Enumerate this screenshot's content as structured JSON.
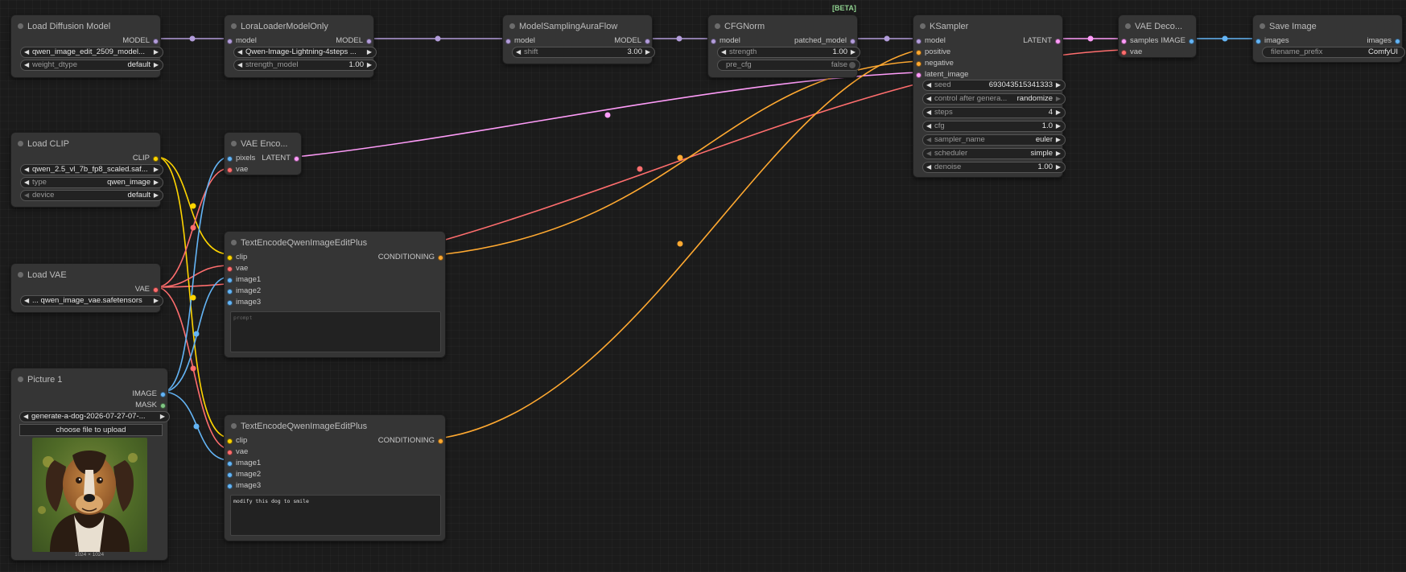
{
  "nodes": {
    "load_diffusion": {
      "title": "Load Diffusion Model",
      "out_model": "MODEL",
      "unet_name": "qwen_image_edit_2509_model...",
      "weight_dtype_label": "weight_dtype",
      "weight_dtype": "default"
    },
    "lora": {
      "title": "LoraLoaderModelOnly",
      "in_model": "model",
      "out_model": "MODEL",
      "lora_name": "Qwen-Image-Lightning-4steps ...",
      "strength_label": "strength_model",
      "strength": "1.00"
    },
    "aura": {
      "title": "ModelSamplingAuraFlow",
      "in_model": "model",
      "out_model": "MODEL",
      "shift_label": "shift",
      "shift": "3.00"
    },
    "cfgnorm": {
      "title": "CFGNorm",
      "badge": "[BETA]",
      "in_model": "model",
      "out": "patched_model",
      "strength_label": "strength",
      "strength": "1.00",
      "pre_cfg_label": "pre_cfg",
      "pre_cfg": "false"
    },
    "ksampler": {
      "title": "KSampler",
      "in_model": "model",
      "in_positive": "positive",
      "in_negative": "negative",
      "in_latent": "latent_image",
      "out": "LATENT",
      "widgets": [
        {
          "label": "seed",
          "value": "693043515341333"
        },
        {
          "label": "control after genera...",
          "value": "randomize"
        },
        {
          "label": "steps",
          "value": "4"
        },
        {
          "label": "cfg",
          "value": "1.0"
        },
        {
          "label": "sampler_name",
          "value": "euler"
        },
        {
          "label": "scheduler",
          "value": "simple"
        },
        {
          "label": "denoise",
          "value": "1.00"
        }
      ]
    },
    "vaedecode": {
      "title": "VAE Deco...",
      "in_samples": "samples",
      "in_vae": "vae",
      "out": "IMAGE"
    },
    "save": {
      "title": "Save Image",
      "in_images": "images",
      "out_images": "images",
      "prefix_label": "filename_prefix",
      "prefix": "ComfyUI"
    },
    "load_clip": {
      "title": "Load CLIP",
      "out": "CLIP",
      "clip_name": "qwen_2.5_vl_7b_fp8_scaled.saf...",
      "type_label": "type",
      "type": "qwen_image",
      "device_label": "device",
      "device": "default"
    },
    "vaeencode": {
      "title": "VAE Enco...",
      "in_pixels": "pixels",
      "in_vae": "vae",
      "out": "LATENT"
    },
    "load_vae": {
      "title": "Load VAE",
      "out": "VAE",
      "vae_name": "... qwen_image_vae.safetensors"
    },
    "picture": {
      "title": "Picture 1",
      "out_image": "IMAGE",
      "out_mask": "MASK",
      "image_name": "generate-a-dog-2026-07-27-07-...",
      "upload": "choose file to upload",
      "dims": "1024 × 1024"
    },
    "encode_neg": {
      "title": "TextEncodeQwenImageEditPlus",
      "out": "CONDITIONING",
      "inputs": [
        "clip",
        "vae",
        "image1",
        "image2",
        "image3"
      ],
      "prompt": "",
      "placeholder": "prompt"
    },
    "encode_pos": {
      "title": "TextEncodeQwenImageEditPlus",
      "out": "CONDITIONING",
      "inputs": [
        "clip",
        "vae",
        "image1",
        "image2",
        "image3"
      ],
      "prompt": "modify this dog to smile"
    }
  },
  "colors": {
    "model": "#b39ddb",
    "clip": "#ffd500",
    "vae": "#ff6e6e",
    "latent": "#ff9cf9",
    "image": "#64b5f6",
    "conditioning": "#ffa931",
    "mask": "#81c784"
  }
}
